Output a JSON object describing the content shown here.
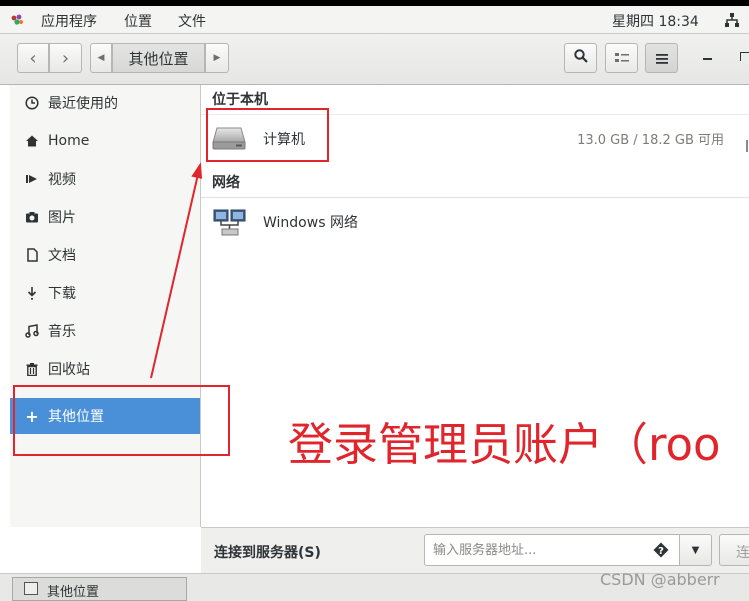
{
  "topbar": {
    "menu_app": "应用程序",
    "menu_places": "位置",
    "menu_files": "文件",
    "clock": "星期四 18:34"
  },
  "headerbar": {
    "path_current": "其他位置"
  },
  "sidebar": {
    "items": [
      {
        "label": "最近使用的",
        "icon": "clock-icon"
      },
      {
        "label": "Home",
        "icon": "home-icon"
      },
      {
        "label": "视频",
        "icon": "video-icon"
      },
      {
        "label": "图片",
        "icon": "camera-icon"
      },
      {
        "label": "文档",
        "icon": "document-icon"
      },
      {
        "label": "下载",
        "icon": "download-icon"
      },
      {
        "label": "音乐",
        "icon": "music-icon"
      },
      {
        "label": "回收站",
        "icon": "trash-icon"
      },
      {
        "label": "其他位置",
        "icon": "plus-icon",
        "active": true
      }
    ]
  },
  "main": {
    "section_local": "位于本机",
    "computer_label": "计算机",
    "computer_size": "13.0 GB / 18.2 GB 可用",
    "section_network": "网络",
    "windows_network_label": "Windows 网络"
  },
  "connect": {
    "label": "连接到服务器(S)",
    "placeholder": "输入服务器地址...",
    "button": "连"
  },
  "statusbar": {
    "text": "其他位置"
  },
  "annotation": {
    "text": "登录管理员账户（roo"
  },
  "watermark": "CSDN @abberr",
  "colors": {
    "accent": "#4a90d9",
    "annotation_red": "#e0262c"
  }
}
